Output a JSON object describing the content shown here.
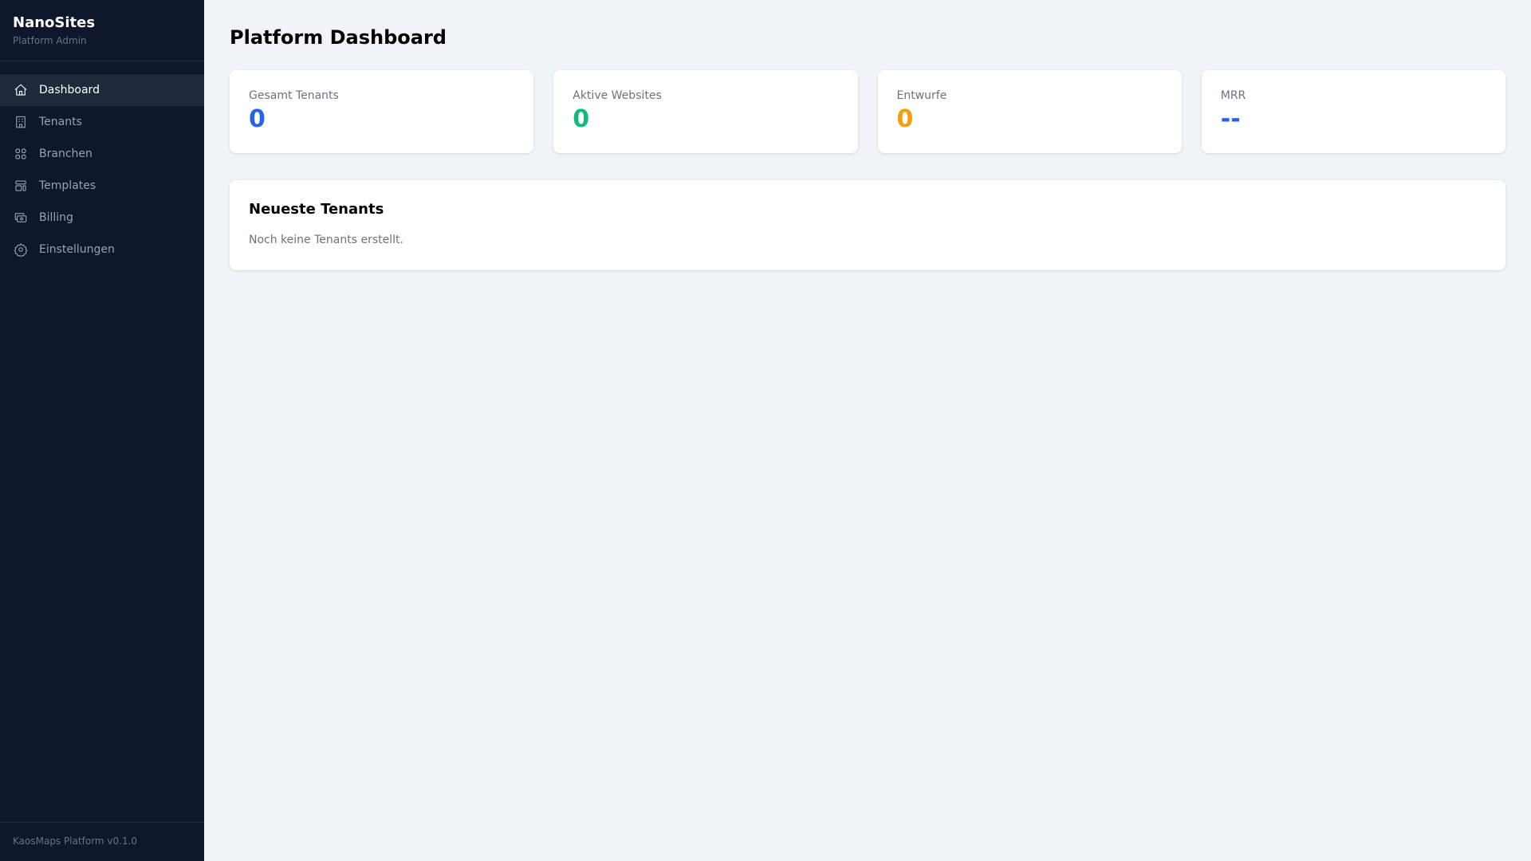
{
  "sidebar": {
    "brand": "NanoSites",
    "subtitle": "Platform Admin",
    "items": [
      {
        "label": "Dashboard",
        "icon": "home-icon"
      },
      {
        "label": "Tenants",
        "icon": "building-icon"
      },
      {
        "label": "Branchen",
        "icon": "grid-icon"
      },
      {
        "label": "Templates",
        "icon": "layout-icon"
      },
      {
        "label": "Billing",
        "icon": "wallet-icon"
      },
      {
        "label": "Einstellungen",
        "icon": "gear-icon"
      }
    ],
    "footer": "KaosMaps Platform v0.1.0"
  },
  "main": {
    "title": "Platform Dashboard",
    "cards": [
      {
        "label": "Gesamt Tenants",
        "value": "0",
        "color": "#2563eb"
      },
      {
        "label": "Aktive Websites",
        "value": "0",
        "color": "#10b981"
      },
      {
        "label": "Entwurfe",
        "value": "0",
        "color": "#f59e0b"
      },
      {
        "label": "MRR",
        "value": "--",
        "color": "#2563eb"
      }
    ],
    "recent": {
      "title": "Neueste Tenants",
      "empty": "Noch keine Tenants erstellt."
    }
  }
}
